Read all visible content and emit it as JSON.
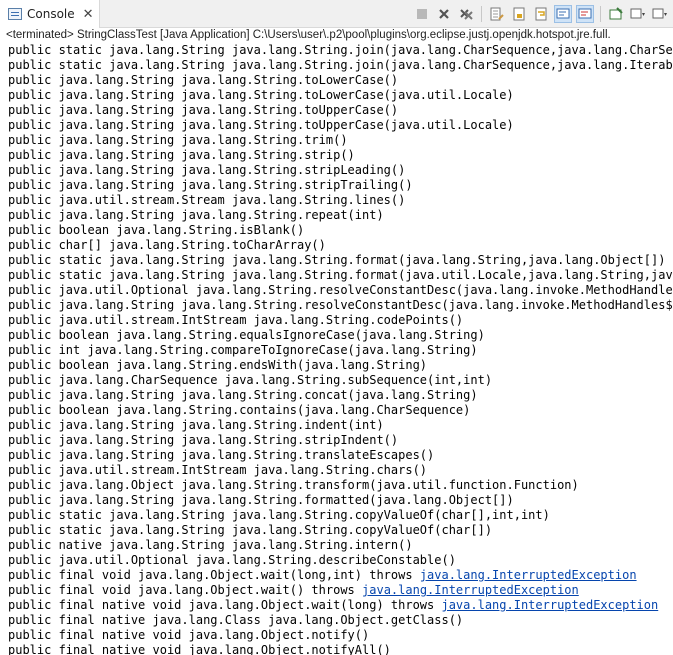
{
  "tab": {
    "label": "Console"
  },
  "status": "<terminated> StringClassTest [Java Application] C:\\Users\\user\\.p2\\pool\\plugins\\org.eclipse.justj.openjdk.hotspot.jre.full.",
  "lines": [
    {
      "text": "public static java.lang.String java.lang.String.join(java.lang.CharSequence,java.lang.CharSeque"
    },
    {
      "text": "public static java.lang.String java.lang.String.join(java.lang.CharSequence,java.lang.Iterable)"
    },
    {
      "text": "public java.lang.String java.lang.String.toLowerCase()"
    },
    {
      "text": "public java.lang.String java.lang.String.toLowerCase(java.util.Locale)"
    },
    {
      "text": "public java.lang.String java.lang.String.toUpperCase()"
    },
    {
      "text": "public java.lang.String java.lang.String.toUpperCase(java.util.Locale)"
    },
    {
      "text": "public java.lang.String java.lang.String.trim()"
    },
    {
      "text": "public java.lang.String java.lang.String.strip()"
    },
    {
      "text": "public java.lang.String java.lang.String.stripLeading()"
    },
    {
      "text": "public java.lang.String java.lang.String.stripTrailing()"
    },
    {
      "text": "public java.util.stream.Stream java.lang.String.lines()"
    },
    {
      "text": "public java.lang.String java.lang.String.repeat(int)"
    },
    {
      "text": "public boolean java.lang.String.isBlank()"
    },
    {
      "text": "public char[] java.lang.String.toCharArray()"
    },
    {
      "text": "public static java.lang.String java.lang.String.format(java.lang.String,java.lang.Object[])"
    },
    {
      "text": "public static java.lang.String java.lang.String.format(java.util.Locale,java.lang.String,java.l"
    },
    {
      "text": "public java.util.Optional java.lang.String.resolveConstantDesc(java.lang.invoke.MethodHandles$Loo"
    },
    {
      "text": "public java.lang.String java.lang.String.resolveConstantDesc(java.lang.invoke.MethodHandles$Loo"
    },
    {
      "text": "public java.util.stream.IntStream java.lang.String.codePoints()"
    },
    {
      "text": "public boolean java.lang.String.equalsIgnoreCase(java.lang.String)"
    },
    {
      "text": "public int java.lang.String.compareToIgnoreCase(java.lang.String)"
    },
    {
      "text": "public boolean java.lang.String.endsWith(java.lang.String)"
    },
    {
      "text": "public java.lang.CharSequence java.lang.String.subSequence(int,int)"
    },
    {
      "text": "public java.lang.String java.lang.String.concat(java.lang.String)"
    },
    {
      "text": "public boolean java.lang.String.contains(java.lang.CharSequence)"
    },
    {
      "text": "public java.lang.String java.lang.String.indent(int)"
    },
    {
      "text": "public java.lang.String java.lang.String.stripIndent()"
    },
    {
      "text": "public java.lang.String java.lang.String.translateEscapes()"
    },
    {
      "text": "public java.util.stream.IntStream java.lang.String.chars()"
    },
    {
      "text": "public java.lang.Object java.lang.String.transform(java.util.function.Function)"
    },
    {
      "text": "public java.lang.String java.lang.String.formatted(java.lang.Object[])"
    },
    {
      "text": "public static java.lang.String java.lang.String.copyValueOf(char[],int,int)"
    },
    {
      "text": "public static java.lang.String java.lang.String.copyValueOf(char[])"
    },
    {
      "text": "public native java.lang.String java.lang.String.intern()"
    },
    {
      "text": "public java.util.Optional java.lang.String.describeConstable()"
    },
    {
      "text": "public final void java.lang.Object.wait(long,int) throws ",
      "link": "java.lang.InterruptedException"
    },
    {
      "text": "public final void java.lang.Object.wait() throws ",
      "link": "java.lang.InterruptedException"
    },
    {
      "text": "public final native void java.lang.Object.wait(long) throws ",
      "link": "java.lang.InterruptedException"
    },
    {
      "text": "public final native java.lang.Class java.lang.Object.getClass()"
    },
    {
      "text": "public final native void java.lang.Object.notify()"
    },
    {
      "text": "public final native void java.lang.Object.notifyAll()"
    }
  ]
}
